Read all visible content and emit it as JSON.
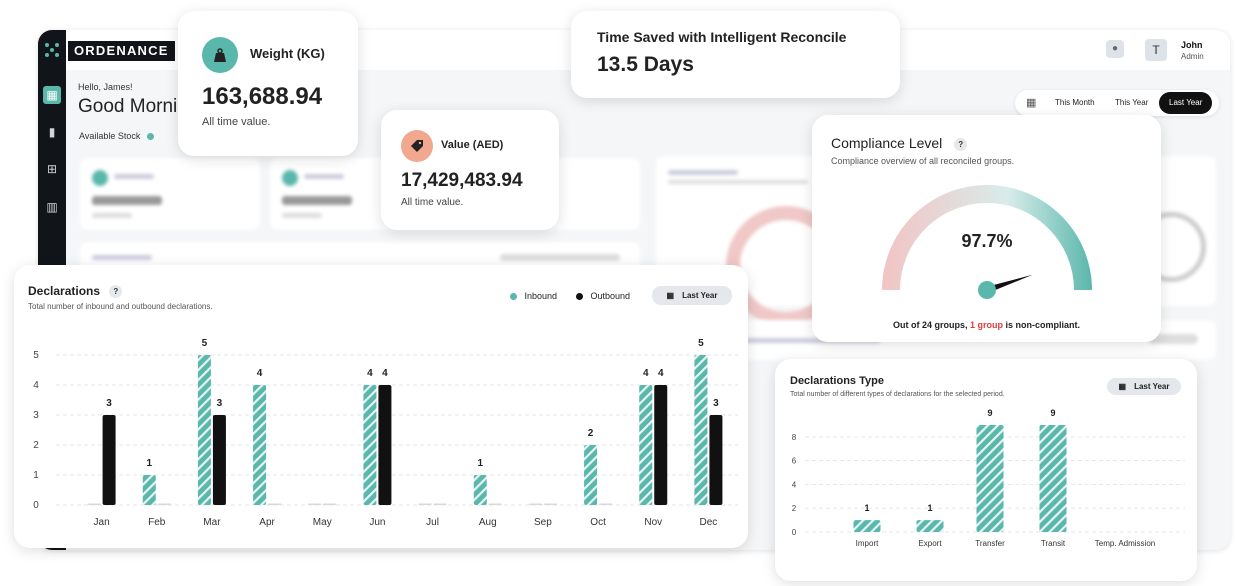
{
  "app": {
    "brand": "ORDENANCE"
  },
  "header": {
    "user_initial": "T",
    "user_name": "John",
    "user_role": "Admin"
  },
  "greeting": {
    "hello": "Hello, James!",
    "title": "Good Morni",
    "available_stock": "Available Stock"
  },
  "period": {
    "options": [
      "This Month",
      "This Year",
      "Last Year"
    ],
    "selected": "Last Year"
  },
  "weight": {
    "title": "Weight (KG)",
    "value": "163,688.94",
    "note": "All time value."
  },
  "value": {
    "title": "Value (AED)",
    "amount": "17,429,483.94",
    "note": "All time value."
  },
  "time_saved": {
    "title": "Time Saved with Intelligent Reconcile",
    "value": "13.5 Days"
  },
  "compliance": {
    "title": "Compliance Level",
    "help": "?",
    "subtitle": "Compliance overview of all reconciled groups.",
    "percent": 97.7,
    "percent_label": "97.7%",
    "footer_pre": "Out of 24 groups,",
    "footer_highlight": "1 group",
    "footer_post": "is non-compliant.",
    "colors": {
      "low": "#f2c4c4",
      "high": "#5ab7ac",
      "highlight": "#e03b3b"
    }
  },
  "declarations": {
    "title": "Declarations",
    "help": "?",
    "subtitle": "Total number of inbound and outbound declarations.",
    "filter": "Last Year",
    "chart_data": {
      "type": "bar",
      "categories": [
        "Jan",
        "Feb",
        "Mar",
        "Apr",
        "May",
        "Jun",
        "Jul",
        "Aug",
        "Sep",
        "Oct",
        "Nov",
        "Dec"
      ],
      "series": [
        {
          "name": "Inbound",
          "color": "#5ab7ac",
          "values": [
            0,
            1,
            5,
            4,
            0,
            4,
            0,
            1,
            0,
            2,
            4,
            5
          ]
        },
        {
          "name": "Outbound",
          "color": "#111111",
          "values": [
            3,
            0,
            3,
            0,
            0,
            4,
            0,
            0,
            0,
            0,
            4,
            3
          ]
        }
      ],
      "yticks": [
        0,
        1,
        2,
        3,
        4,
        5
      ],
      "ylim": [
        0,
        5
      ],
      "legend": "top-right",
      "grid": true
    }
  },
  "declaration_types": {
    "title": "Declarations Type",
    "subtitle": "Total number of different types of declarations for the selected period.",
    "filter": "Last Year",
    "chart_data": {
      "type": "bar",
      "categories": [
        "Import",
        "Export",
        "Transfer",
        "Transit",
        "Temp. Admission"
      ],
      "values": [
        1,
        1,
        9,
        9,
        0
      ],
      "yticks": [
        0,
        2,
        4,
        6,
        8
      ],
      "ylim": [
        0,
        9.5
      ],
      "color": "#5ab7ac",
      "grid": true
    }
  }
}
